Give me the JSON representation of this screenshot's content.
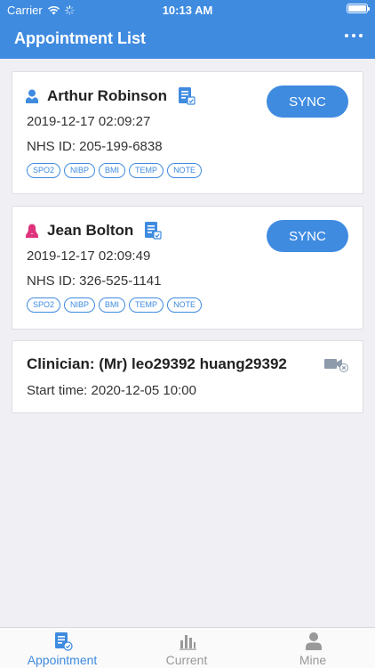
{
  "status": {
    "carrier": "Carrier",
    "time": "10:13 AM"
  },
  "header": {
    "title": "Appointment List"
  },
  "patients": [
    {
      "name": "Arthur Robinson",
      "gender": "male",
      "datetime": "2019-12-17 02:09:27",
      "nhs": "NHS ID:  205-199-6838",
      "sync_label": "SYNC",
      "tags": [
        "SPO2",
        "NIBP",
        "BMI",
        "TEMP",
        "NOTE"
      ]
    },
    {
      "name": "Jean Bolton",
      "gender": "female",
      "datetime": "2019-12-17 02:09:49",
      "nhs": "NHS ID:  326-525-1141",
      "sync_label": "SYNC",
      "tags": [
        "SPO2",
        "NIBP",
        "BMI",
        "TEMP",
        "NOTE"
      ]
    }
  ],
  "clinician": {
    "line": "Clinician: (Mr) leo29392 huang29392",
    "start": "Start time: 2020-12-05 10:00"
  },
  "tabs": [
    {
      "label": "Appointment",
      "icon": "appointment-icon"
    },
    {
      "label": "Current",
      "icon": "bar-chart-icon"
    },
    {
      "label": "Mine",
      "icon": "user-icon"
    }
  ],
  "colors": {
    "accent": "#3f8be0",
    "male": "#3f8be0",
    "female": "#e0337e",
    "inactive": "#999999"
  }
}
